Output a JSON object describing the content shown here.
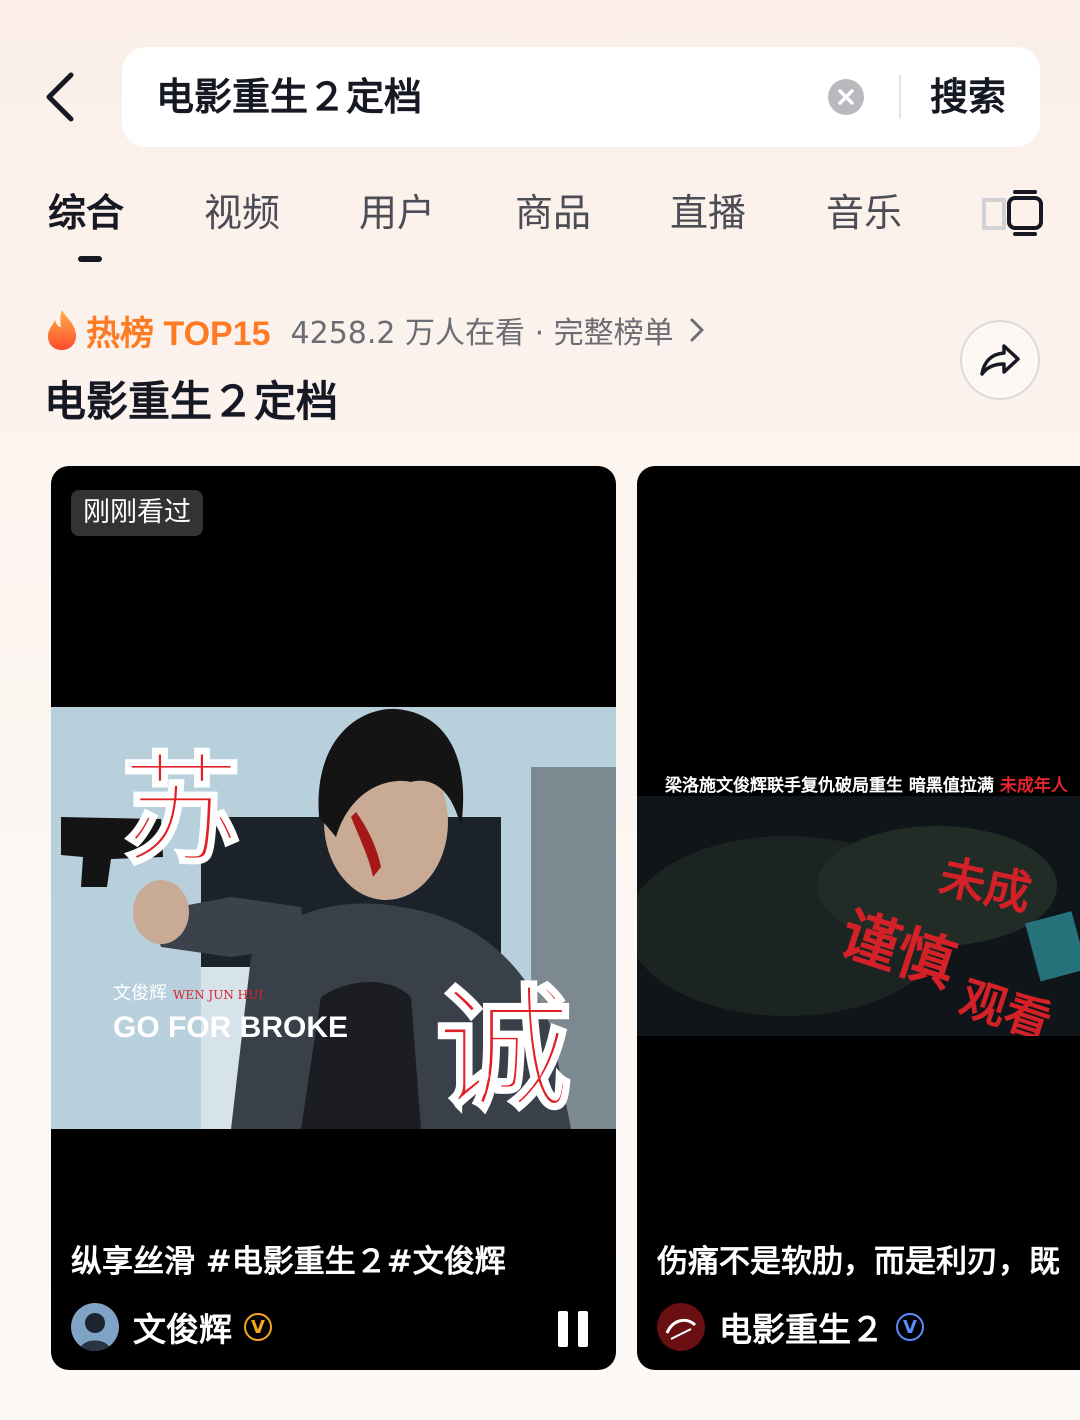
{
  "search": {
    "query": "电影重生２定档",
    "submit_label": "搜索"
  },
  "tabs": [
    {
      "label": "综合",
      "active": true
    },
    {
      "label": "视频"
    },
    {
      "label": "用户"
    },
    {
      "label": "商品"
    },
    {
      "label": "直播"
    },
    {
      "label": "音乐"
    }
  ],
  "hot": {
    "title": "热榜 TOP15",
    "meta": "4258.2 万人在看 · 完整榜单",
    "accent_color": "#fe7a23"
  },
  "topic_title": "电影重生２定档",
  "cards": [
    {
      "badge": "刚刚看过",
      "thumb_text": {
        "big1": "苏",
        "big2": "诚",
        "small_cn": "文俊辉",
        "small_en": "WEN JUN HUI",
        "tagline": "GO FOR BROKE"
      },
      "caption": "纵享丝滑 #电影重生２#文俊辉",
      "author": "文俊辉",
      "verify_color": "#f5a623",
      "playing": true
    },
    {
      "overlay": {
        "text": "梁洛施文俊辉联手复仇破局重生 暗黑值拉满",
        "red": "未成年人"
      },
      "thumb_text": {
        "line1": "未成",
        "line2": "谨慎",
        "line3": "观看"
      },
      "caption": "伤痛不是软肋，而是利刃，既",
      "author": "电影重生２",
      "verify_color": "#5a8cff"
    }
  ],
  "icons": [
    "back-arrow-icon",
    "clear-icon",
    "filter-icon",
    "fire-icon",
    "chevron-right-icon",
    "share-icon",
    "verified-icon",
    "pause-icon"
  ]
}
